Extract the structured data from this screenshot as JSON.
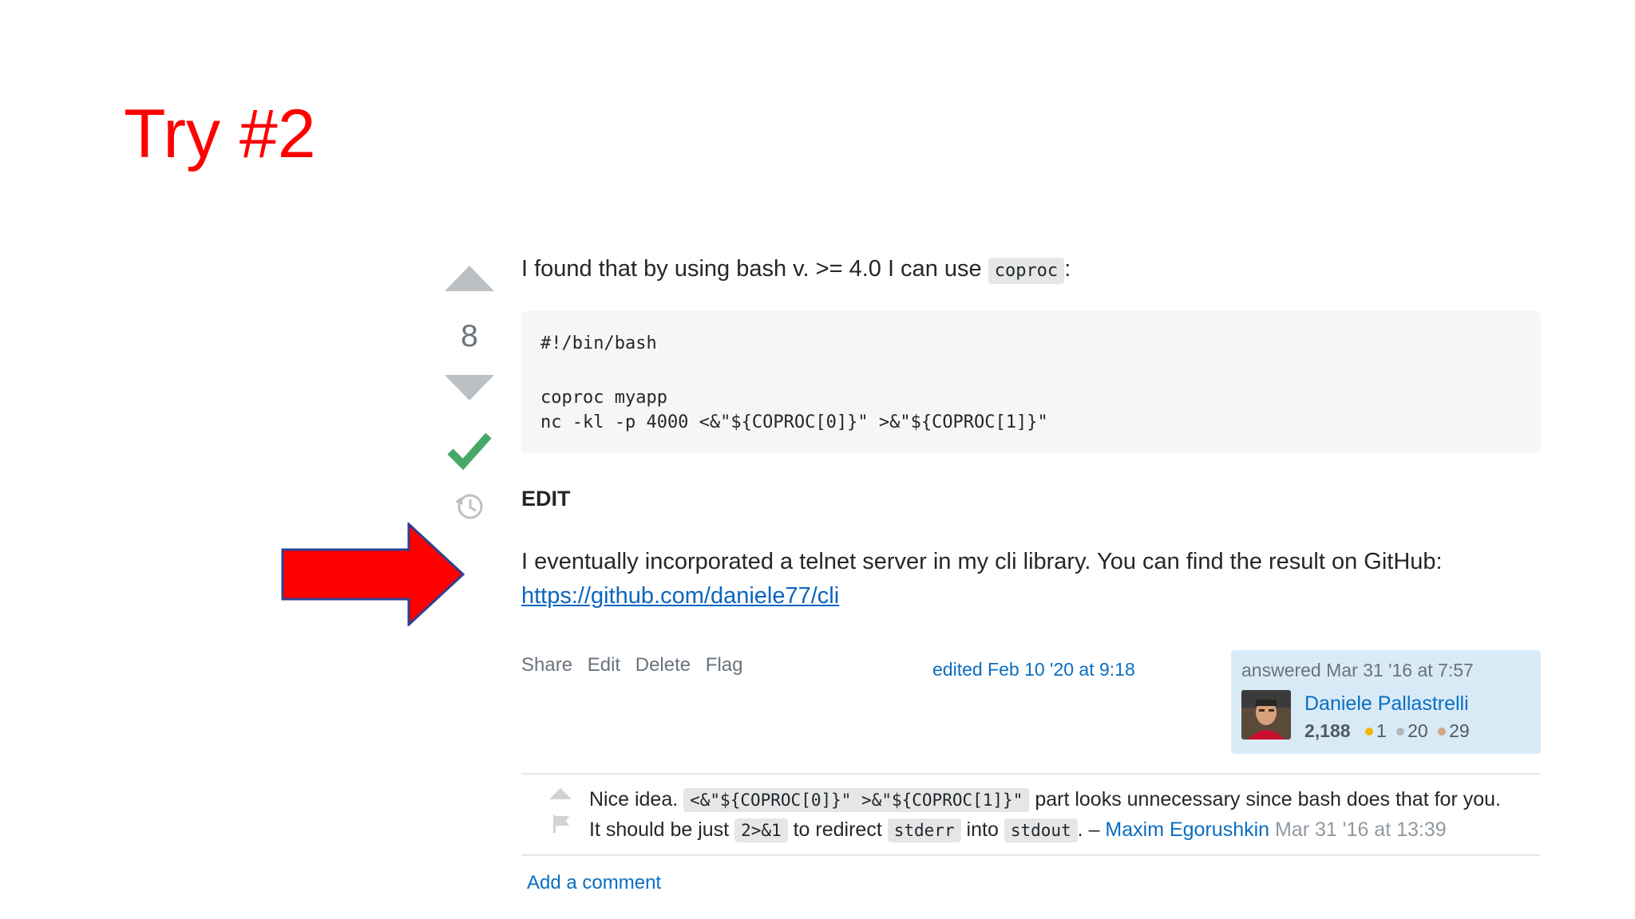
{
  "slide": {
    "title": "Try #2"
  },
  "vote": {
    "count": "8"
  },
  "answer": {
    "intro_text": "I found that by using bash v. >= 4.0 I can use",
    "intro_code": "coproc",
    "intro_suffix": ":",
    "code_lines": [
      "#!/bin/bash",
      "coproc myapp",
      "nc -kl -p 4000 <&\"${COPROC[0]}\" >&\"${COPROC[1]}\""
    ],
    "edit_heading": "EDIT",
    "edit_text": "I eventually incorporated a telnet server in my cli library. You can find the result on GitHub:",
    "edit_link": "https://github.com/daniele77/cli"
  },
  "post_menu": {
    "share": "Share",
    "edit": "Edit",
    "delete": "Delete",
    "flag": "Flag"
  },
  "edited": "edited Feb 10 '20 at 9:18",
  "user_card": {
    "answered": "answered Mar 31 '16 at 7:57",
    "name": "Daniele Pallastrelli",
    "reputation": "2,188",
    "gold": "1",
    "silver": "20",
    "bronze": "29",
    "gold_color": "#f1b600",
    "silver_color": "#b4b8bc",
    "bronze_color": "#d1a684"
  },
  "comment": {
    "text1": "Nice idea.",
    "code1": "<&\"${COPROC[0]}\" >&\"${COPROC[1]}\"",
    "text2": "part looks unnecessary since bash does that for you.",
    "text3": "It should be just",
    "code2": "2>&1",
    "text4": "to redirect",
    "code3": "stderr",
    "text5": "into",
    "code4": "stdout",
    "text6": ". –",
    "user": "Maxim Egorushkin",
    "date": "Mar 31 '16 at 13:39"
  },
  "add_comment": "Add a comment",
  "colors": {
    "title_red": "#ff0000",
    "arrow_red": "#ff0000",
    "accepted_green": "#48a868",
    "link_blue": "#0c65c0"
  }
}
